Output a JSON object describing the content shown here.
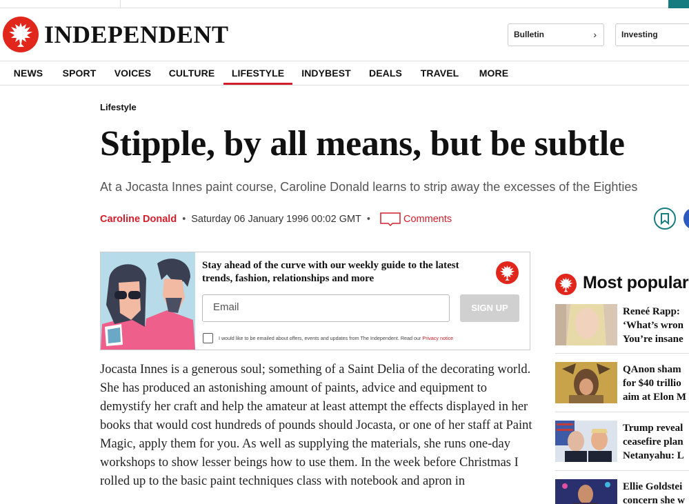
{
  "brand": {
    "name": "INDEPENDENT",
    "red": "#e1261c",
    "accent_red": "#d21d2b",
    "teal": "#167c80"
  },
  "header": {
    "pills": [
      {
        "label": "Bulletin",
        "icon": "chevron-right-icon"
      },
      {
        "label": "Investing"
      }
    ]
  },
  "nav": {
    "items": [
      {
        "label": "NEWS"
      },
      {
        "label": "SPORT"
      },
      {
        "label": "VOICES"
      },
      {
        "label": "CULTURE"
      },
      {
        "label": "LIFESTYLE",
        "active": true
      },
      {
        "label": "INDYBEST"
      },
      {
        "label": "DEALS"
      },
      {
        "label": "TRAVEL"
      },
      {
        "label": "MORE"
      }
    ]
  },
  "article": {
    "kicker": "Lifestyle",
    "headline": "Stipple, by all means, but be subtle",
    "standfirst": "At a Jocasta Innes paint course, Caroline Donald learns to strip away the excesses of the Eighties",
    "author": "Caroline Donald",
    "date": "Saturday 06 January 1996 00:02 GMT",
    "comments_label": "Comments",
    "body": "Jocasta Innes is a generous soul; something of a Saint Delia of the decorating world. She has produced an astonishing amount of paints, advice and equipment to demystify her craft and help the amateur at least attempt the effects displayed in her books that would cost hundreds of pounds should Jocasta, or one of her staff at Paint Magic, apply them for you. As well as supplying the materials, she runs one-day workshops to show lesser beings how to use them. In the week before Christmas I rolled up to the basic paint techniques class with notebook and apron in"
  },
  "newsletter": {
    "headline": "Stay ahead of the curve with our weekly guide to the latest trends, fashion, relationships and more",
    "email_placeholder": "Email",
    "signup_label": "SIGN UP",
    "consent_text": "I would like to be emailed about offers, events and updates from The Independent. Read our",
    "privacy_link": "Privacy notice"
  },
  "most_popular": {
    "title": "Most popular",
    "items": [
      {
        "line1": "Reneé Rapp:",
        "line2": "‘What’s wron",
        "line3": "You’re insane"
      },
      {
        "line1": "QAnon sham",
        "line2": "for $40 trillio",
        "line3": "aim at Elon M"
      },
      {
        "line1": "Trump reveal",
        "line2": "ceasefire plan",
        "line3": "Netanyahu: L"
      },
      {
        "line1": "Ellie Goldstei",
        "line2": "concern she w",
        "line3": ""
      }
    ]
  }
}
